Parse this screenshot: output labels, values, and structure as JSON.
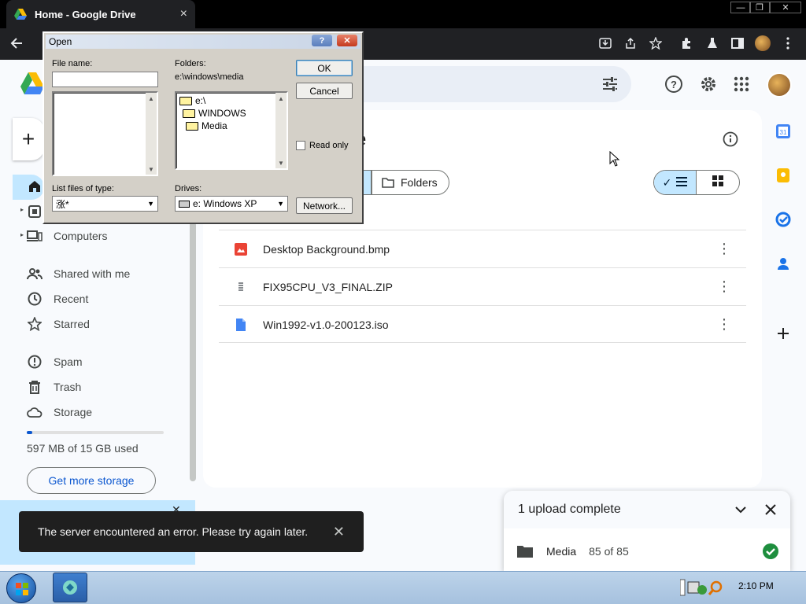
{
  "browser": {
    "tab_title": "Home - Google Drive",
    "tab_close": "×",
    "win_minimize": "—",
    "win_restore": "❐",
    "win_close": "✕"
  },
  "sidebar": {
    "items": [
      {
        "label": "Computers",
        "icon": "computers-icon"
      },
      {
        "label": "Shared with me",
        "icon": "people-icon"
      },
      {
        "label": "Recent",
        "icon": "clock-icon"
      },
      {
        "label": "Starred",
        "icon": "star-icon"
      },
      {
        "label": "Spam",
        "icon": "spam-icon"
      },
      {
        "label": "Trash",
        "icon": "trash-icon"
      },
      {
        "label": "Storage",
        "icon": "cloud-icon"
      }
    ],
    "storage_used_fraction": 0.04,
    "storage_text": "597 MB of 15 GB used",
    "get_storage": "Get more storage"
  },
  "main": {
    "title_tail": "e",
    "chip_folders": "Folders",
    "files": [
      {
        "name": "Desktop Background.bmp",
        "icon": "image-file-icon",
        "color": "#ea4335"
      },
      {
        "name": "FIX95CPU_V3_FINAL.ZIP",
        "icon": "zip-file-icon",
        "color": "#5f6368"
      },
      {
        "name": "Win1992-v1.0-200123.iso",
        "icon": "generic-file-icon",
        "color": "#4285f4"
      }
    ]
  },
  "upload": {
    "title": "1 upload complete",
    "item_name": "Media",
    "item_count": "85 of 85"
  },
  "snackbar": {
    "message": "The server encountered an error. Please try again later."
  },
  "dialog": {
    "title": "Open",
    "help_btn": "?",
    "close_btn": "✕",
    "file_name_label": "File name:",
    "file_name_value": "",
    "folders_label": "Folders:",
    "current_path": "e:\\windows\\media",
    "folders": [
      "e:\\",
      "WINDOWS",
      "Media"
    ],
    "ok": "OK",
    "cancel": "Cancel",
    "read_only": "Read only",
    "list_type_label": "List files of type:",
    "list_type_value": "涨*",
    "drives_label": "Drives:",
    "drives_value": "e: Windows XP",
    "network": "Network..."
  },
  "taskbar": {
    "clock": "2:10 PM"
  }
}
